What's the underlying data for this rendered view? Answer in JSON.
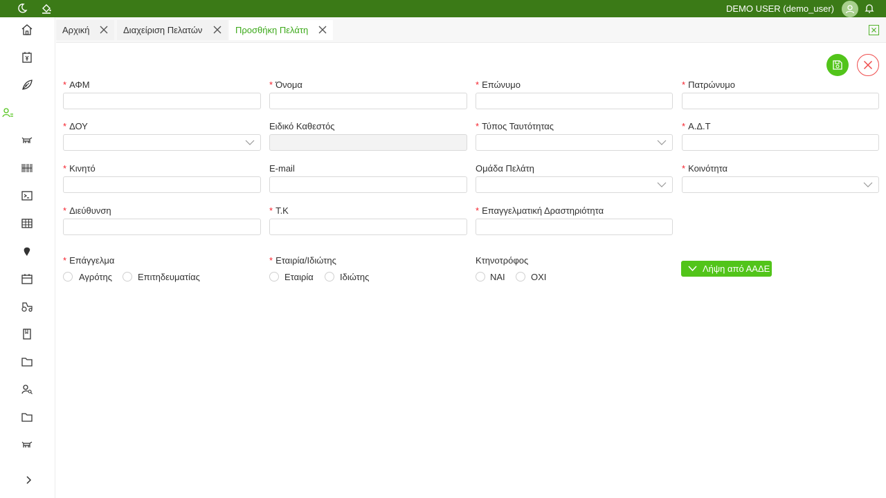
{
  "header": {
    "user": "DEMO USER (demo_user)",
    "icons": [
      "moon-icon",
      "paint-bucket-icon",
      "user-avatar-icon",
      "bell-icon"
    ]
  },
  "sidebar": {
    "items": [
      "home-icon",
      "calendar-yen-icon",
      "leaf-icon",
      "user-settings-icon",
      "cow-icon",
      "barcode-icon",
      "terminal-icon",
      "table-icon",
      "map-pin-icon",
      "calendar-icon",
      "tractor-icon",
      "book-icon",
      "folder-icon",
      "user-search-icon",
      "folder-icon",
      "cow-icon"
    ],
    "expand_icon": "chevron-right-icon"
  },
  "tabs": [
    {
      "label": "Αρχική",
      "active": false
    },
    {
      "label": "Διαχείριση Πελατών",
      "active": false
    },
    {
      "label": "Προσθήκη Πελάτη",
      "active": true
    }
  ],
  "colors": {
    "brand": "#3b7a17",
    "accent": "#52c41a",
    "danger": "#ef4a4a",
    "required": "#f5222d"
  },
  "form": {
    "afm_label": "ΑΦΜ",
    "name_label": "Όνομα",
    "surname_label": "Επώνυμο",
    "father_label": "Πατρώνυμο",
    "doy_label": "ΔΟΥ",
    "special_status_label": "Ειδικό Καθεστός",
    "id_type_label": "Τύπος Ταυτότητας",
    "adt_label": "Α.Δ.Τ",
    "mobile_label": "Κινητό",
    "email_label": "E-mail",
    "customer_group_label": "Ομάδα Πελάτη",
    "community_label": "Κοινότητα",
    "address_label": "Διεύθυνση",
    "tk_label": "Τ.Κ",
    "activity_label": "Επαγγελματική Δραστηριότητα",
    "profession_label": "Επάγγελμα",
    "profession_options": [
      "Αγρότης",
      "Επιτηδευματίας"
    ],
    "company_label": "Εταιρία/Ιδιώτης",
    "company_options": [
      "Εταιρία",
      "Ιδιώτης"
    ],
    "livestock_label": "Κτηνοτρόφος",
    "livestock_options": [
      "ΝΑΙ",
      "ΟΧΙ"
    ],
    "aade_button": "Λήψη από ΑΑΔΕ"
  }
}
